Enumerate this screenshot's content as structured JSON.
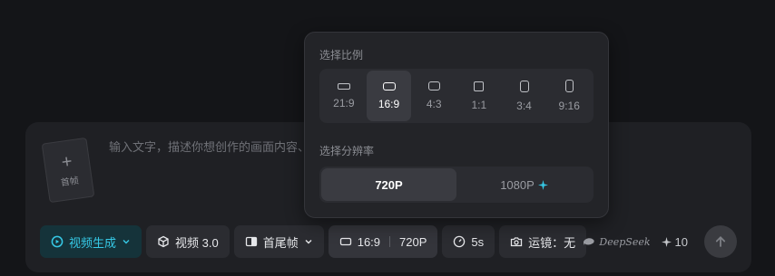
{
  "composer": {
    "first_frame_plus": "+",
    "first_frame_label": "首帧",
    "placeholder": "输入文字，描述你想创作的画面内容、运动方式等。例如：一个小男孩在公园里开心地玩滑滑板。",
    "toolbar": {
      "mode": "视频生成",
      "model": "视频 3.0",
      "frames": "首尾帧",
      "ratio": "16:9",
      "resolution": "720P",
      "duration": "5s",
      "camera": "运镜：无"
    },
    "brand": "DeepSeek",
    "credits": "10"
  },
  "popover": {
    "ratio_title": "选择比例",
    "ratios": [
      {
        "label": "21:9",
        "selected": false
      },
      {
        "label": "16:9",
        "selected": true
      },
      {
        "label": "4:3",
        "selected": false
      },
      {
        "label": "1:1",
        "selected": false
      },
      {
        "label": "3:4",
        "selected": false
      },
      {
        "label": "9:16",
        "selected": false
      }
    ],
    "resolution_title": "选择分辨率",
    "resolutions": [
      {
        "label": "720P",
        "selected": true
      },
      {
        "label": "1080P",
        "selected": false,
        "badge": "sparkle-icon"
      }
    ]
  },
  "colors": {
    "accent": "#36c9e6",
    "panel": "#1f2024",
    "popover": "#232428"
  }
}
